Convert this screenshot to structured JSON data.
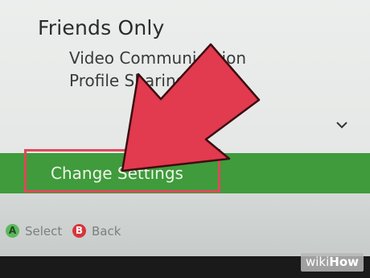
{
  "settings": {
    "heading": "Friends Only",
    "options": [
      "Video Communication",
      "Profile Sharing"
    ],
    "action_label": "Change Settings"
  },
  "footer": {
    "a_glyph": "A",
    "a_label": "Select",
    "b_glyph": "B",
    "b_label": "Back"
  },
  "watermark": {
    "part1": "wiki",
    "part2": "How"
  },
  "colors": {
    "accent_green": "#3f9b3b",
    "highlight_red": "#e0475a",
    "arrow_red": "#e23a4e"
  },
  "icons": {
    "chevron": "chevron-down-icon"
  }
}
